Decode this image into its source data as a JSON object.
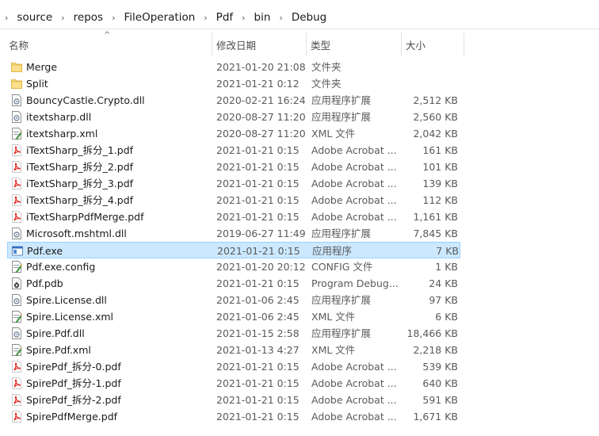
{
  "breadcrumb": {
    "items": [
      "source",
      "repos",
      "FileOperation",
      "Pdf",
      "bin",
      "Debug"
    ]
  },
  "columns": {
    "name": "名称",
    "date": "修改日期",
    "type": "类型",
    "size": "大小"
  },
  "files": [
    {
      "name": "Merge",
      "date": "2021-01-20 21:08",
      "type": "文件夹",
      "size": "",
      "icon": "folder-icon"
    },
    {
      "name": "Split",
      "date": "2021-01-21 0:12",
      "type": "文件夹",
      "size": "",
      "icon": "folder-icon"
    },
    {
      "name": "BouncyCastle.Crypto.dll",
      "date": "2020-02-21 16:24",
      "type": "应用程序扩展",
      "size": "2,512 KB",
      "icon": "dll-icon"
    },
    {
      "name": "itextsharp.dll",
      "date": "2020-08-27 11:20",
      "type": "应用程序扩展",
      "size": "2,560 KB",
      "icon": "dll-icon"
    },
    {
      "name": "itextsharp.xml",
      "date": "2020-08-27 11:20",
      "type": "XML 文件",
      "size": "2,042 KB",
      "icon": "xml-icon"
    },
    {
      "name": "iTextSharp_拆分_1.pdf",
      "date": "2021-01-21 0:15",
      "type": "Adobe Acrobat ...",
      "size": "161 KB",
      "icon": "pdf-icon"
    },
    {
      "name": "iTextSharp_拆分_2.pdf",
      "date": "2021-01-21 0:15",
      "type": "Adobe Acrobat ...",
      "size": "101 KB",
      "icon": "pdf-icon"
    },
    {
      "name": "iTextSharp_拆分_3.pdf",
      "date": "2021-01-21 0:15",
      "type": "Adobe Acrobat ...",
      "size": "139 KB",
      "icon": "pdf-icon"
    },
    {
      "name": "iTextSharp_拆分_4.pdf",
      "date": "2021-01-21 0:15",
      "type": "Adobe Acrobat ...",
      "size": "112 KB",
      "icon": "pdf-icon"
    },
    {
      "name": "iTextSharpPdfMerge.pdf",
      "date": "2021-01-21 0:15",
      "type": "Adobe Acrobat ...",
      "size": "1,161 KB",
      "icon": "pdf-icon"
    },
    {
      "name": "Microsoft.mshtml.dll",
      "date": "2019-06-27 11:49",
      "type": "应用程序扩展",
      "size": "7,845 KB",
      "icon": "dll-icon"
    },
    {
      "name": "Pdf.exe",
      "date": "2021-01-21 0:15",
      "type": "应用程序",
      "size": "7 KB",
      "icon": "exe-icon",
      "selected": true
    },
    {
      "name": "Pdf.exe.config",
      "date": "2021-01-20 20:12",
      "type": "CONFIG 文件",
      "size": "1 KB",
      "icon": "config-icon"
    },
    {
      "name": "Pdf.pdb",
      "date": "2021-01-21 0:15",
      "type": "Program Debug...",
      "size": "24 KB",
      "icon": "pdb-icon"
    },
    {
      "name": "Spire.License.dll",
      "date": "2021-01-06 2:45",
      "type": "应用程序扩展",
      "size": "97 KB",
      "icon": "dll-icon"
    },
    {
      "name": "Spire.License.xml",
      "date": "2021-01-06 2:45",
      "type": "XML 文件",
      "size": "6 KB",
      "icon": "xml-icon"
    },
    {
      "name": "Spire.Pdf.dll",
      "date": "2021-01-15 2:58",
      "type": "应用程序扩展",
      "size": "18,466 KB",
      "icon": "dll-icon"
    },
    {
      "name": "Spire.Pdf.xml",
      "date": "2021-01-13 4:27",
      "type": "XML 文件",
      "size": "2,218 KB",
      "icon": "xml-icon"
    },
    {
      "name": "SpirePdf_拆分-0.pdf",
      "date": "2021-01-21 0:15",
      "type": "Adobe Acrobat ...",
      "size": "539 KB",
      "icon": "pdf-icon"
    },
    {
      "name": "SpirePdf_拆分-1.pdf",
      "date": "2021-01-21 0:15",
      "type": "Adobe Acrobat ...",
      "size": "640 KB",
      "icon": "pdf-icon"
    },
    {
      "name": "SpirePdf_拆分-2.pdf",
      "date": "2021-01-21 0:15",
      "type": "Adobe Acrobat ...",
      "size": "591 KB",
      "icon": "pdf-icon"
    },
    {
      "name": "SpirePdfMerge.pdf",
      "date": "2021-01-21 0:15",
      "type": "Adobe Acrobat ...",
      "size": "1,671 KB",
      "icon": "pdf-icon"
    }
  ],
  "colors": {
    "selection_bg": "#cce8ff",
    "selection_border": "#99d1ff",
    "folder": "#f7d26b",
    "pdf_red": "#e2231a"
  }
}
